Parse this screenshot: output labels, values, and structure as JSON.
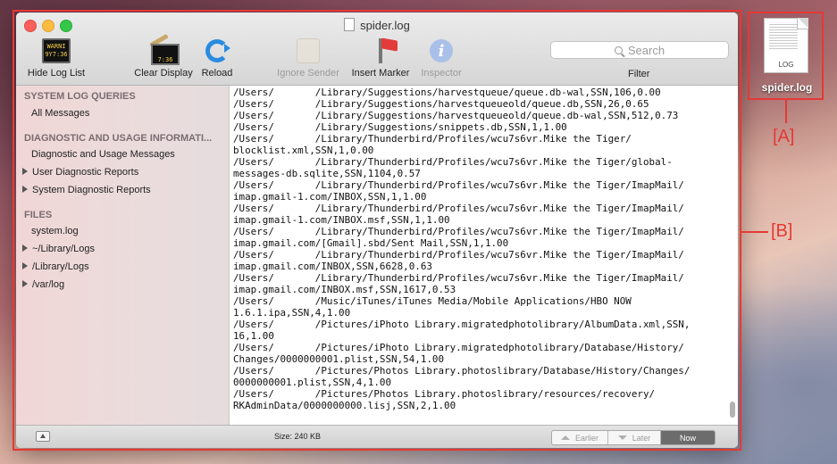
{
  "window": {
    "title": "spider.log"
  },
  "toolbar": {
    "hide_log_list": "Hide Log List",
    "clear_display": "Clear Display",
    "reload": "Reload",
    "ignore_sender": "Ignore Sender",
    "insert_marker": "Insert Marker",
    "inspector": "Inspector",
    "search_placeholder": "Search",
    "filter": "Filter",
    "console_icon_text": [
      "WARNI",
      "9Y7:36"
    ],
    "clear_icon_text": "7:36"
  },
  "sidebar": {
    "sections": [
      {
        "heading": "SYSTEM LOG QUERIES",
        "items": [
          {
            "label": "All Messages",
            "disclosure": false
          }
        ]
      },
      {
        "heading": "DIAGNOSTIC AND USAGE INFORMATI...",
        "items": [
          {
            "label": "Diagnostic and Usage Messages",
            "disclosure": false
          },
          {
            "label": "User Diagnostic Reports",
            "disclosure": true
          },
          {
            "label": "System Diagnostic Reports",
            "disclosure": true
          }
        ]
      },
      {
        "heading": "FILES",
        "items": [
          {
            "label": "system.log",
            "disclosure": false
          },
          {
            "label": "~/Library/Logs",
            "disclosure": true
          },
          {
            "label": "/Library/Logs",
            "disclosure": true
          },
          {
            "label": "/var/log",
            "disclosure": true
          }
        ]
      }
    ]
  },
  "log": {
    "lines": [
      "/Users/       /Library/Suggestions/harvestqueue/queue.db-wal,SSN,106,0.00",
      "/Users/       /Library/Suggestions/harvestqueueold/queue.db,SSN,26,0.65",
      "/Users/       /Library/Suggestions/harvestqueueold/queue.db-wal,SSN,512,0.73",
      "/Users/       /Library/Suggestions/snippets.db,SSN,1,1.00",
      "/Users/       /Library/Thunderbird/Profiles/wcu7s6vr.Mike the Tiger/",
      "blocklist.xml,SSN,1,0.00",
      "/Users/       /Library/Thunderbird/Profiles/wcu7s6vr.Mike the Tiger/global-",
      "messages-db.sqlite,SSN,1104,0.57",
      "/Users/       /Library/Thunderbird/Profiles/wcu7s6vr.Mike the Tiger/ImapMail/",
      "imap.gmail-1.com/INBOX,SSN,1,1.00",
      "/Users/       /Library/Thunderbird/Profiles/wcu7s6vr.Mike the Tiger/ImapMail/",
      "imap.gmail-1.com/INBOX.msf,SSN,1,1.00",
      "/Users/       /Library/Thunderbird/Profiles/wcu7s6vr.Mike the Tiger/ImapMail/",
      "imap.gmail.com/[Gmail].sbd/Sent Mail,SSN,1,1.00",
      "/Users/       /Library/Thunderbird/Profiles/wcu7s6vr.Mike the Tiger/ImapMail/",
      "imap.gmail.com/INBOX,SSN,6628,0.63",
      "/Users/       /Library/Thunderbird/Profiles/wcu7s6vr.Mike the Tiger/ImapMail/",
      "imap.gmail.com/INBOX.msf,SSN,1617,0.53",
      "/Users/       /Music/iTunes/iTunes Media/Mobile Applications/HBO NOW",
      "1.6.1.ipa,SSN,4,1.00",
      "/Users/       /Pictures/iPhoto Library.migratedphotolibrary/AlbumData.xml,SSN,",
      "16,1.00",
      "/Users/       /Pictures/iPhoto Library.migratedphotolibrary/Database/History/",
      "Changes/0000000001.plist,SSN,54,1.00",
      "/Users/       /Pictures/Photos Library.photoslibrary/Database/History/Changes/",
      "0000000001.plist,SSN,4,1.00",
      "/Users/       /Pictures/Photos Library.photoslibrary/resources/recovery/",
      "RKAdminData/0000000000.lisj,SSN,2,1.00"
    ]
  },
  "statusbar": {
    "size": "Size: 240 KB",
    "earlier": "Earlier",
    "later": "Later",
    "now": "Now"
  },
  "desktop": {
    "file_ext": "LOG",
    "file_name": "spider.log"
  },
  "annotations": {
    "a": "[A]",
    "b": "[B]",
    "color": "#e53935"
  }
}
